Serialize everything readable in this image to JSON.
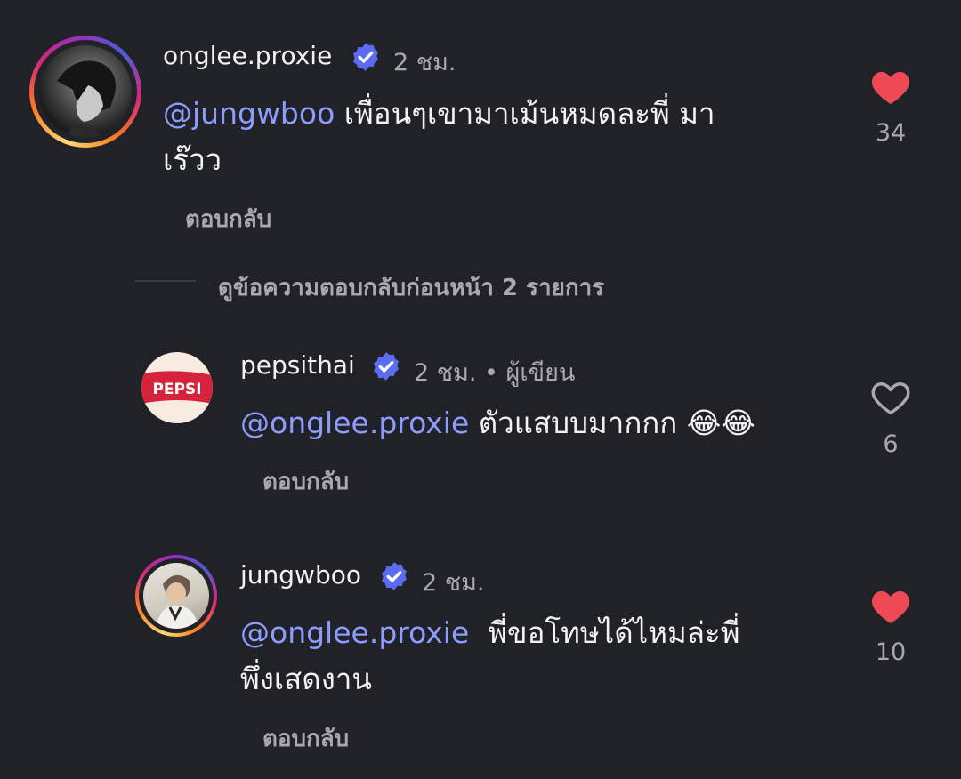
{
  "comments": [
    {
      "username": "onglee.proxie",
      "time": "2 ชม.",
      "mention": "@jungwboo",
      "text_line1": " เพื่อนๆเขามาเม้นหมดละพี่ มา",
      "text_line2": "เร๊วว",
      "reply_label": "ตอบกลับ",
      "likes": "34",
      "liked": true
    },
    {
      "username": "pepsithai",
      "time": "2 ชม. • ผู้เขียน",
      "mention": "@onglee.proxie",
      "text_line1": " ตัวแสบบมากกก 😂😂",
      "reply_label": "ตอบกลับ",
      "likes": "6",
      "liked": false,
      "avatar_text": "PEPSI"
    },
    {
      "username": "jungwboo",
      "time": "2 ชม.",
      "mention": "@onglee.proxie",
      "text_line1": "  พี่ขอโทษได้ไหมล่ะพี่",
      "text_line2": "พึ่งเสดงาน",
      "reply_label": "ตอบกลับ",
      "likes": "10",
      "liked": true
    }
  ],
  "view_previous_replies": "ดูข้อความตอบกลับก่อนหน้า 2 รายการ",
  "colors": {
    "background": "#212228",
    "mention": "#8c9cff",
    "verified": "#5b6cf0",
    "like": "#ed4956"
  },
  "icons": {
    "verified": "verified-badge-icon",
    "heart_filled": "heart-filled-icon",
    "heart_outline": "heart-outline-icon"
  }
}
